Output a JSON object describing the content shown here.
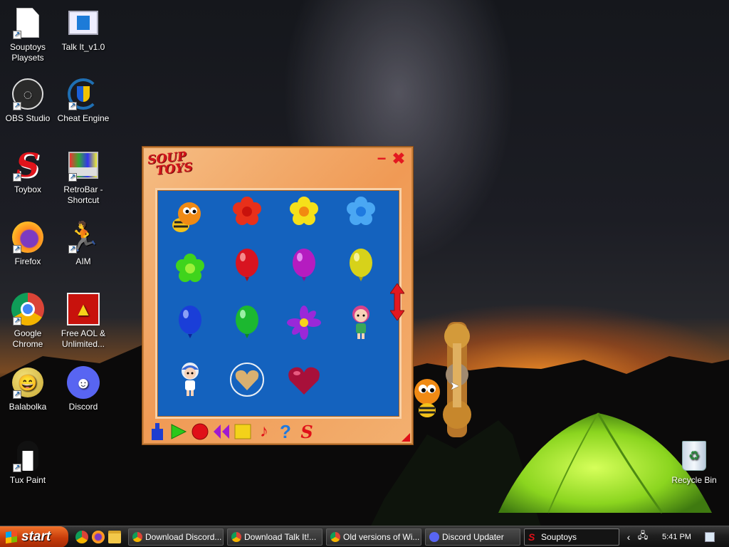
{
  "desktop": {
    "icons": [
      {
        "label": "Souptoys Playsets",
        "icon": "file-icon"
      },
      {
        "label": "Talk It_v1.0",
        "icon": "app-window-icon"
      },
      {
        "label": "OBS Studio",
        "icon": "obs-icon"
      },
      {
        "label": "Cheat Engine",
        "icon": "cheat-engine-icon"
      },
      {
        "label": "Toybox",
        "icon": "souptoys-s-icon"
      },
      {
        "label": "RetroBar - Shortcut",
        "icon": "retrobar-icon"
      },
      {
        "label": "Firefox",
        "icon": "firefox-icon"
      },
      {
        "label": "AIM",
        "icon": "aim-runner-icon"
      },
      {
        "label": "Google Chrome",
        "icon": "chrome-icon"
      },
      {
        "label": "Free AOL & Unlimited...",
        "icon": "aol-icon"
      },
      {
        "label": "Balabolka",
        "icon": "balabolka-icon"
      },
      {
        "label": "Discord",
        "icon": "discord-icon"
      },
      {
        "label": "Tux Paint",
        "icon": "tux-icon"
      },
      {
        "label": "Recycle Bin",
        "icon": "recycle-bin-icon"
      }
    ]
  },
  "souptoys": {
    "logo_line1": "SOUP",
    "logo_line2": "TOYS",
    "minimize_glyph": "−",
    "close_glyph": "✖",
    "toys": [
      "bee",
      "red flower",
      "yellow flower",
      "blue flower",
      "green flower",
      "red balloon",
      "purple balloon",
      "yellow balloon",
      "blue balloon",
      "green balloon",
      "purple flower",
      "girl doll pink hair",
      "girl doll",
      "gold heart",
      "red heart"
    ],
    "toolbar": [
      "tool-icon",
      "play-icon",
      "record-icon",
      "rewind-icon",
      "stop-icon",
      "music-icon",
      "help-icon",
      "souptoys-s-icon"
    ]
  },
  "taskbar": {
    "start_label": "start",
    "tasks": [
      {
        "label": "Download Discord...",
        "icon": "chrome-icon"
      },
      {
        "label": "Download Talk It!...",
        "icon": "chrome-icon"
      },
      {
        "label": "Old versions of Wi...",
        "icon": "chrome-icon"
      },
      {
        "label": "Discord Updater",
        "icon": "discord-icon"
      },
      {
        "label": "Souptoys",
        "icon": "souptoys-s-icon",
        "active": true
      }
    ],
    "clock": "5:41 PM"
  },
  "colors": {
    "window_bg": "#f2a660",
    "panel_bg": "#1462be",
    "start_green": "#c73c0a",
    "logo_red": "#d3141b"
  }
}
